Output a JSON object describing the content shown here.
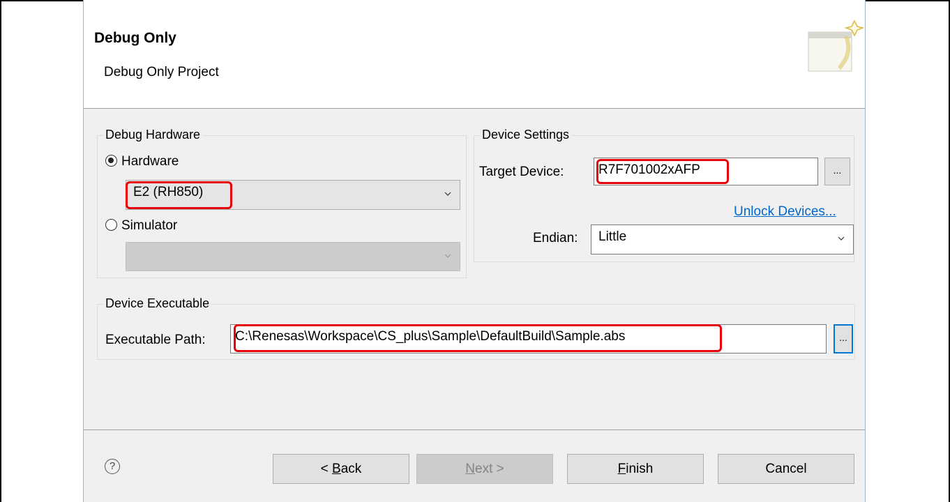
{
  "header": {
    "title": "Debug Only",
    "subtitle": "Debug Only Project",
    "icon": "wizard-banner-icon"
  },
  "debug_hardware": {
    "group_title": "Debug Hardware",
    "hardware_label": "Hardware",
    "hardware_selected": true,
    "hardware_value": "E2 (RH850)",
    "simulator_label": "Simulator",
    "simulator_selected": false,
    "simulator_value": ""
  },
  "device_settings": {
    "group_title": "Device Settings",
    "target_device_label": "Target Device:",
    "target_device_value": "R7F701002xAFP",
    "browse_label": "...",
    "unlock_link": "Unlock Devices...",
    "endian_label": "Endian:",
    "endian_value": "Little"
  },
  "device_executable": {
    "group_title": "Device Executable",
    "path_label": "Executable Path:",
    "path_value": "C:\\Renesas\\Workspace\\CS_plus\\Sample\\DefaultBuild\\Sample.abs",
    "browse_label": "..."
  },
  "buttons": {
    "help": "?",
    "back": "< Back",
    "back_mnemonic": "B",
    "next": "Next >",
    "next_mnemonic": "N",
    "finish": "Finish",
    "finish_mnemonic": "F",
    "cancel": "Cancel"
  },
  "colors": {
    "highlight": "#e8000b",
    "link": "#0066cc",
    "focus": "#0078d7"
  }
}
